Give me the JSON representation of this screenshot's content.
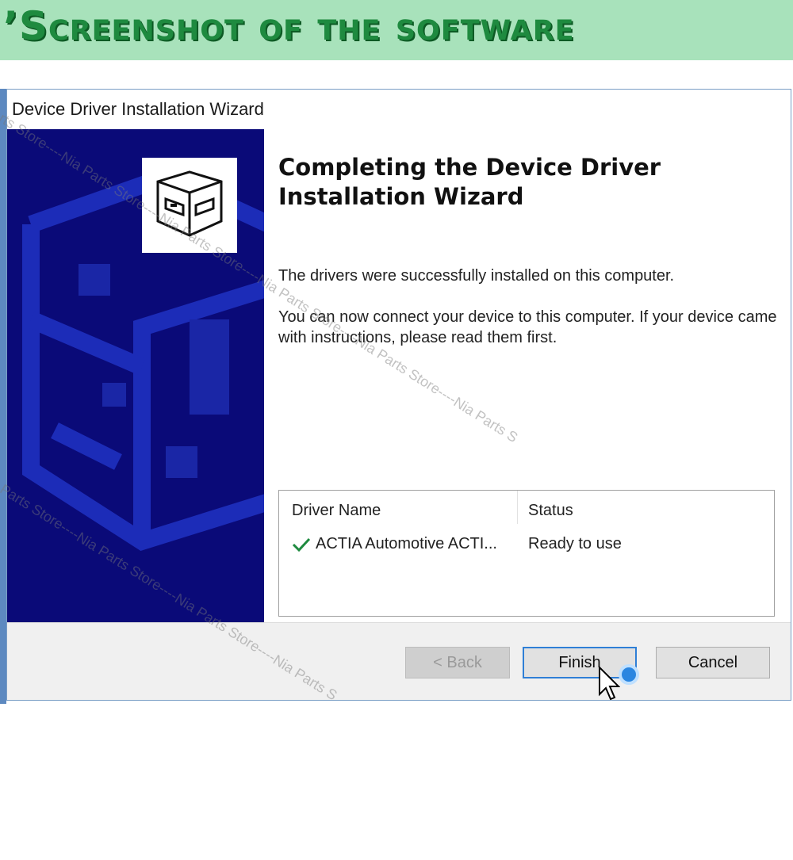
{
  "banner": {
    "title": "’Screenshot of the software"
  },
  "window": {
    "title": "Device Driver Installation Wizard"
  },
  "wizard": {
    "heading_line1": "Completing the Device Driver",
    "heading_line2": "Installation Wizard",
    "message1": "The drivers were successfully installed on this computer.",
    "message2": "You can now connect your device to this computer. If your device came with instructions, please read them first."
  },
  "driver_table": {
    "headers": [
      "Driver Name",
      "Status"
    ],
    "rows": [
      {
        "name": "ACTIA Automotive ACTI...",
        "status": "Ready to use"
      }
    ]
  },
  "buttons": {
    "back": "< Back",
    "finish": "Finish",
    "cancel": "Cancel"
  },
  "watermark": {
    "text1": "Nia Parts Store----Nia Parts Store----Nia Parts Store----Nia Parts Store----Nia Parts Store----Nia Parts S",
    "text2": "Nia Parts Store----Nia Parts Store----Nia Parts Store----Nia Parts S"
  },
  "colors": {
    "banner_bg": "#a8e2bb",
    "banner_text": "#1e8a3f",
    "side_panel": "#0a0a78",
    "check_green": "#1e8a3f",
    "focus_blue": "#2f7fd6"
  }
}
